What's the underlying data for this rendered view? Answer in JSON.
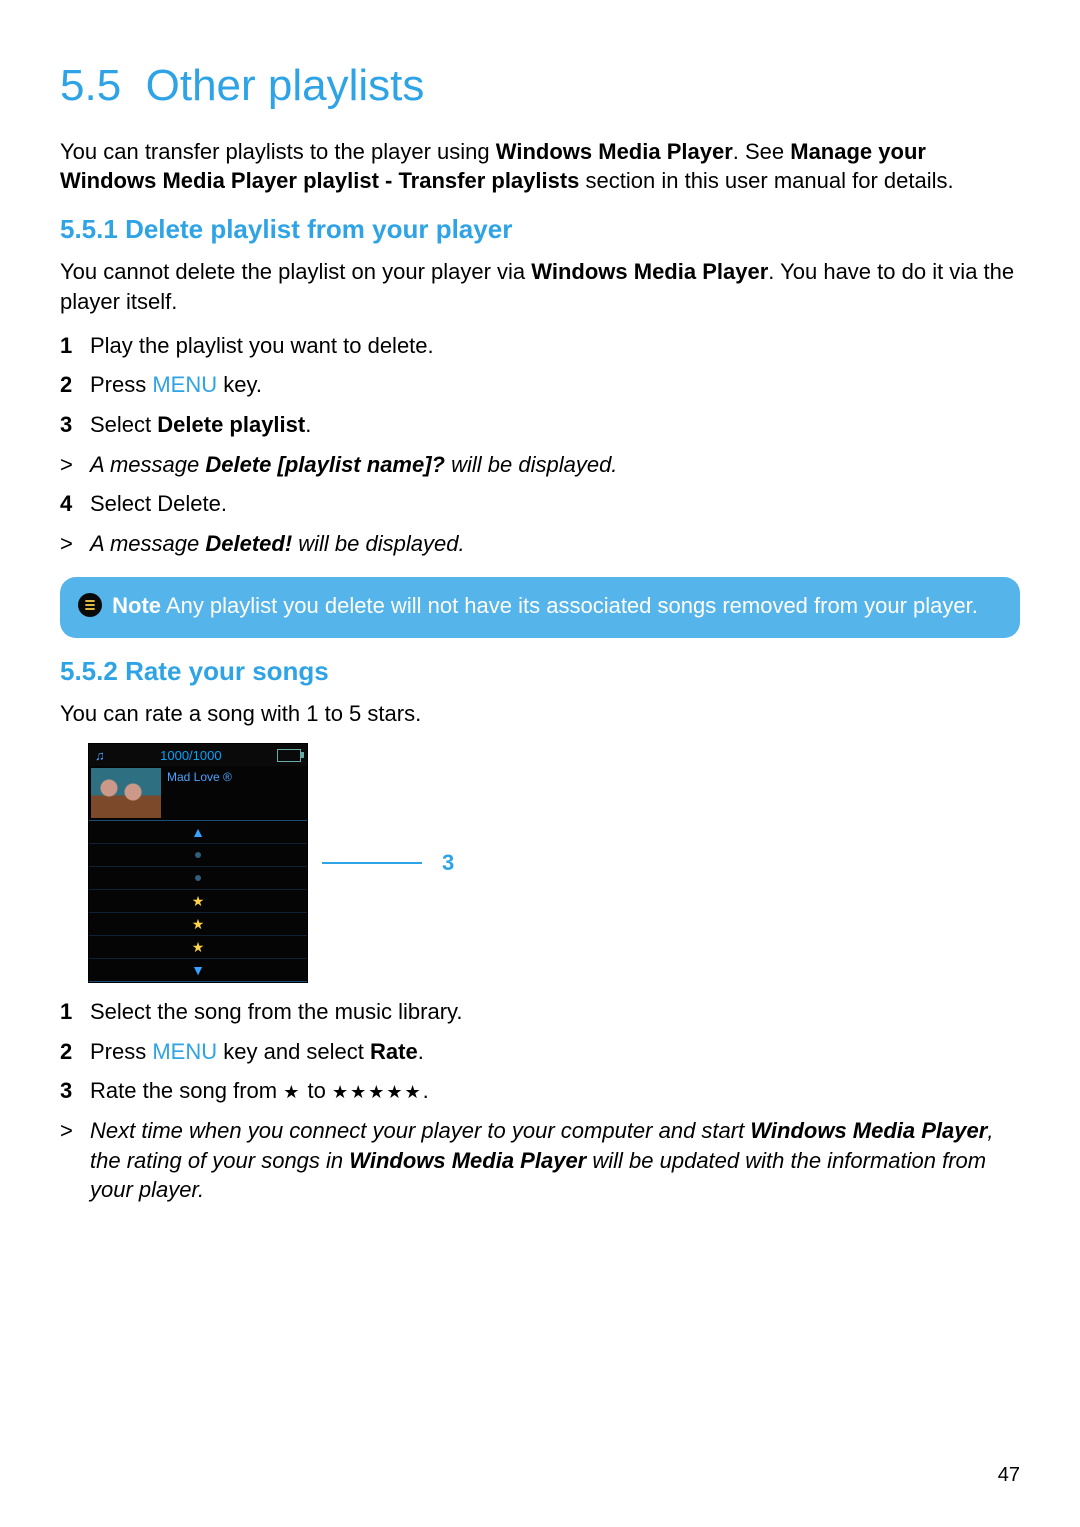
{
  "section": {
    "number": "5.5",
    "title": "Other playlists"
  },
  "intro": {
    "pre": "You can transfer playlists to the player using ",
    "b1": "Windows Media Player",
    "mid1": ". See ",
    "b2": "Manage your Windows Media Player playlist - Transfer playlists",
    "post": " section in this user manual for details."
  },
  "sub1": {
    "number": "5.5.1",
    "title": "Delete playlist from your player",
    "para_pre": "You cannot delete the playlist on your player via ",
    "para_b": "Windows Media Player",
    "para_post": ". You have to do it via the player itself.",
    "steps": {
      "s1": "Play the playlist you want to delete.",
      "s2_pre": "Press ",
      "s2_menu": "MENU",
      "s2_post": " key.",
      "s3_pre": "Select ",
      "s3_b": "Delete playlist",
      "s3_post": ".",
      "r1_pre": "A message ",
      "r1_b": "Delete [playlist name]?",
      "r1_post": " will be displayed.",
      "s4": "Select Delete.",
      "r2_pre": "A message ",
      "r2_b": "Deleted!",
      "r2_post": " will be displayed."
    }
  },
  "note": {
    "label": "Note",
    "text": " Any playlist you delete will not have its associated songs removed from your player."
  },
  "sub2": {
    "number": "5.5.2",
    "title": "Rate your songs",
    "intro": "You can rate a song with 1 to 5 stars.",
    "player": {
      "counter": "1000/1000",
      "now_playing": "Mad Love ®"
    },
    "callout": "3",
    "steps": {
      "s1": "Select the song from the music library.",
      "s2_pre": "Press ",
      "s2_menu": "MENU",
      "s2_mid": " key and select ",
      "s2_b": "Rate",
      "s2_post": ".",
      "s3_pre": "Rate the song from ",
      "s3_mid": " to ",
      "s3_post": ".",
      "r1_pre": "Next time when you connect your player to your computer and start ",
      "r1_b1": "Windows Media Player",
      "r1_mid": ", the rating of your songs in ",
      "r1_b2": "Windows Media Player",
      "r1_post": " will be updated with the information from your player."
    },
    "stars": {
      "one": "★",
      "five": "★★★★★"
    }
  },
  "page_number": "47"
}
